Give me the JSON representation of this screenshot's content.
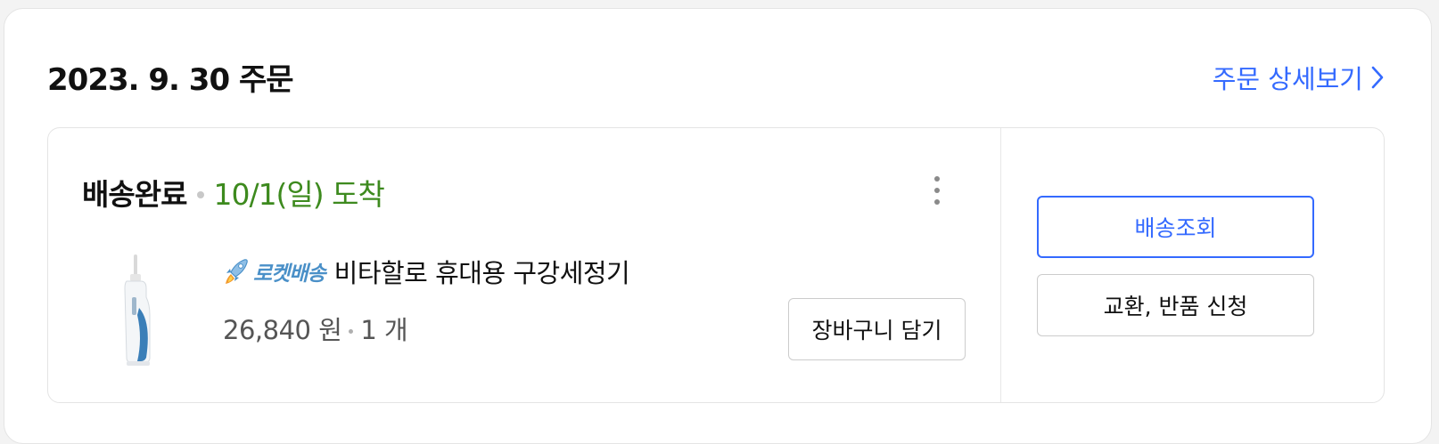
{
  "order": {
    "date_title": "2023. 9. 30 주문",
    "detail_link_label": "주문 상세보기"
  },
  "shipment": {
    "status": "배송완료",
    "arrival": "10/1(일) 도착"
  },
  "product": {
    "badge_label": "로켓배송",
    "name": "비타할로 휴대용 구강세정기",
    "price": "26,840 원",
    "quantity": "1 개"
  },
  "actions": {
    "add_to_cart": "장바구니 담기",
    "track_delivery": "배송조회",
    "exchange_return": "교환, 반품 신청"
  },
  "icons": {
    "detail_chevron": "chevron-right-icon",
    "more": "more-vertical-icon",
    "rocket": "rocket-icon",
    "thumbnail": "product-thumbnail"
  },
  "colors": {
    "accent": "#346aff",
    "arrival_green": "#3d8a1e",
    "rocket_blue": "#4a90c8"
  }
}
